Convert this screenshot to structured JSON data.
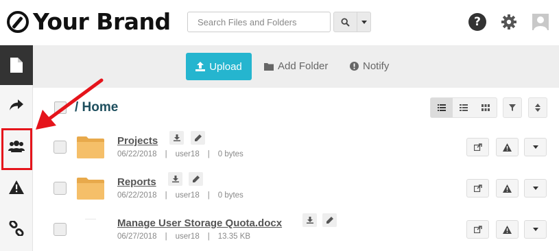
{
  "brand": {
    "name": "Your Brand"
  },
  "search": {
    "placeholder": "Search Files and Folders"
  },
  "toolbar": {
    "upload_label": "Upload",
    "add_folder_label": "Add Folder",
    "notify_label": "Notify"
  },
  "breadcrumb": {
    "title": "/ Home"
  },
  "colors": {
    "accent": "#25b5cf",
    "highlight": "#e5141b",
    "folder": "#f3b95f",
    "heading": "#1e4f5e"
  },
  "sidebar": {
    "items": [
      {
        "icon": "file-icon",
        "active": true
      },
      {
        "icon": "share-arrow-icon",
        "active": false
      },
      {
        "icon": "users-icon",
        "active": false,
        "highlighted": true
      },
      {
        "icon": "warning-icon",
        "active": false
      },
      {
        "icon": "link-icon",
        "active": false
      }
    ]
  },
  "files": [
    {
      "name": "Projects",
      "type": "folder",
      "date": "06/22/2018",
      "owner": "user18",
      "size": "0 bytes"
    },
    {
      "name": "Reports",
      "type": "folder",
      "date": "06/22/2018",
      "owner": "user18",
      "size": "0 bytes"
    },
    {
      "name": "Manage User Storage Quota.docx",
      "type": "file",
      "date": "06/27/2018",
      "owner": "user18",
      "size": "13.35 KB"
    }
  ]
}
